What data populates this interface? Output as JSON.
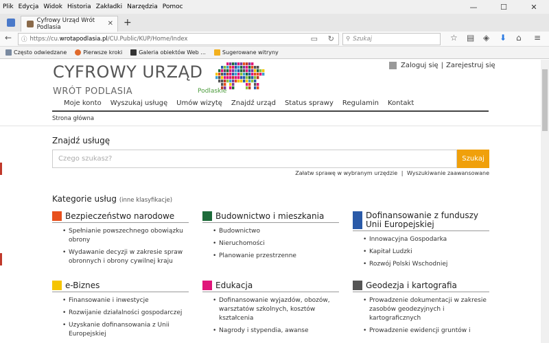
{
  "menubar": {
    "items": [
      "Plik",
      "Edycja",
      "Widok",
      "Historia",
      "Zakładki",
      "Narzędzia",
      "Pomoc"
    ]
  },
  "window_controls": {
    "minimize": "—",
    "maximize": "☐",
    "close": "✕"
  },
  "tab": {
    "title": "Cyfrowy Urząd Wrót Podlasia",
    "close": "✕",
    "new_tab": "+"
  },
  "nav": {
    "back": "←",
    "info": "ⓘ",
    "url_prefix": "https://cu.",
    "url_host": "wrotapodlasia.pl",
    "url_path": "/CU.Public/KUP/Home/Index",
    "reader": "▭",
    "reload": "↻",
    "search_placeholder": "Szukaj",
    "star": "☆",
    "library": "▤",
    "shield": "◈",
    "download": "⬇",
    "home": "⌂",
    "menu": "≡"
  },
  "bookmarks": [
    "Często odwiedzane",
    "Pierwsze kroki",
    "Galeria obiektów Web ...",
    "Sugerowane witryny"
  ],
  "site": {
    "brand_line1": "CYFROWY URZĄD",
    "brand_line2": "WRÓT PODLASIA",
    "logo_text": "Podlaskie",
    "login": "Zaloguj się",
    "separator": "|",
    "register": "Zarejestruj się",
    "mainnav": [
      "Moje konto",
      "Wyszukaj usługę",
      "Umów wizytę",
      "Znajdź urząd",
      "Status sprawy",
      "Regulamin",
      "Kontakt"
    ],
    "breadcrumb": "Strona główna"
  },
  "search": {
    "heading": "Znajdź usługę",
    "placeholder": "Czego szukasz?",
    "button": "Szukaj",
    "link1": "Załatw sprawę w wybranym urzędzie",
    "link_sep": "|",
    "link2": "Wyszukiwanie zaawansowane"
  },
  "categories": {
    "heading": "Kategorie usług",
    "alt": "(inne klasyfikacje)",
    "items": [
      {
        "title": "Bezpieczeństwo narodowe",
        "color": "#e8501d",
        "links": [
          "Spełnianie powszechnego obowiązku obrony",
          "Wydawanie decyzji w zakresie spraw obronnych i obrony cywilnej kraju"
        ]
      },
      {
        "title": "Budownictwo i mieszkania",
        "color": "#1d6b3a",
        "links": [
          "Budownictwo",
          "Nieruchomości",
          "Planowanie przestrzenne"
        ]
      },
      {
        "title": "Dofinansowanie z funduszy Unii Europejskiej",
        "color": "#2a5aa8",
        "links": [
          "Innowacyjna Gospodarka",
          "Kapitał Ludzki",
          "Rozwój Polski Wschodniej"
        ]
      },
      {
        "title": "e-Biznes",
        "color": "#f5c400",
        "links": [
          "Finansowanie i inwestycje",
          "Rozwijanie działalności gospodarczej",
          "Uzyskanie dofinansowania z Unii Europejskiej"
        ]
      },
      {
        "title": "Edukacja",
        "color": "#e0157a",
        "links": [
          "Dofinansowanie wyjazdów, obozów, warsztatów szkolnych, kosztów kształcenia",
          "Nagrody i stypendia, awanse"
        ]
      },
      {
        "title": "Geodezja i kartografia",
        "color": "#555555",
        "links": [
          "Prowadzenie dokumentacji w zakresie zasobów geodezyjnych i kartograficznych",
          "Prowadzenie ewidencji gruntów i"
        ]
      }
    ]
  }
}
